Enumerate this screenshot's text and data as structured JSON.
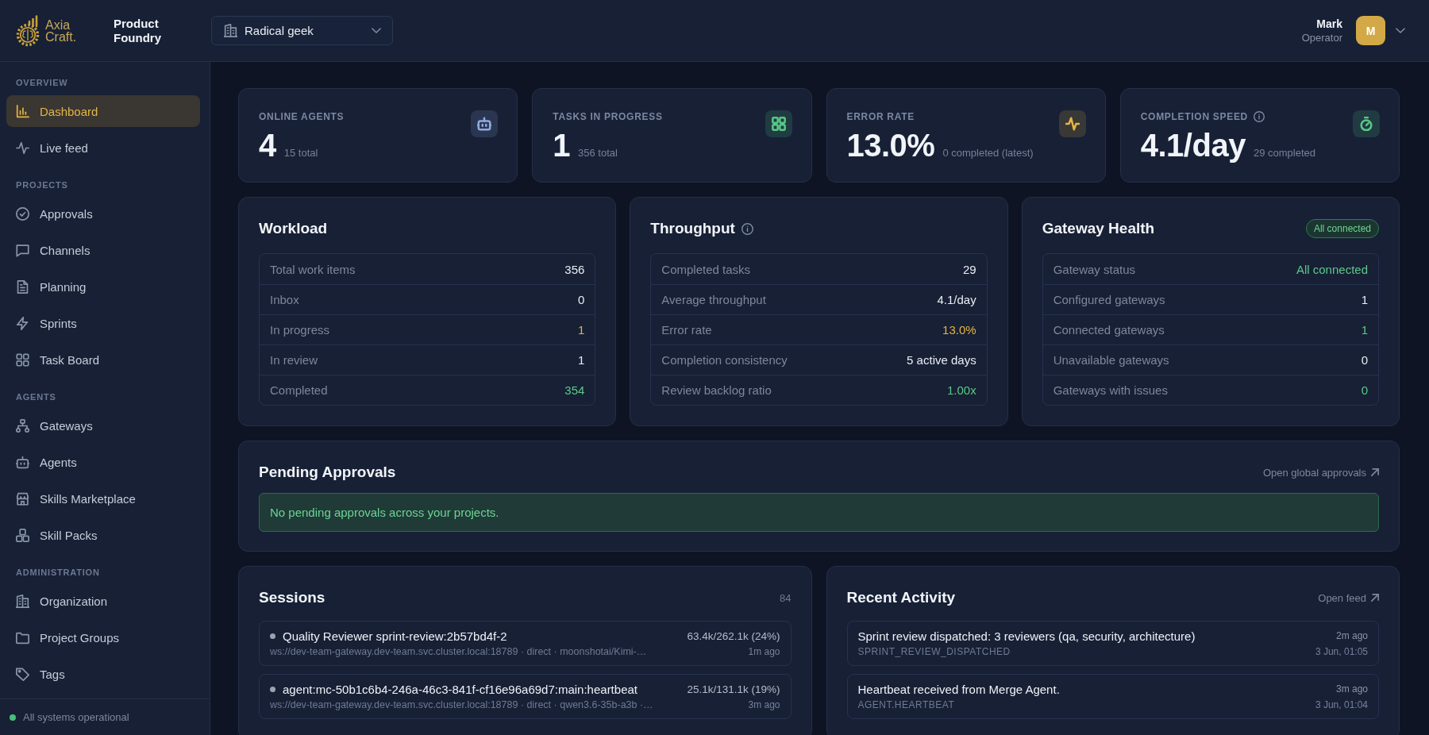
{
  "header": {
    "logo": {
      "lines": [
        "Axia",
        "Craft."
      ]
    },
    "app_name": "Product Foundry",
    "org_selector": {
      "value": "Radical geek"
    },
    "user": {
      "name": "Mark",
      "role": "Operator",
      "initial": "M"
    }
  },
  "sidebar": {
    "sections": [
      {
        "title": "OVERVIEW",
        "items": [
          {
            "label": "Dashboard",
            "selected": true
          },
          {
            "label": "Live feed",
            "selected": false
          }
        ]
      },
      {
        "title": "PROJECTS",
        "items": [
          {
            "label": "Approvals",
            "selected": false
          },
          {
            "label": "Channels",
            "selected": false
          },
          {
            "label": "Planning",
            "selected": false
          },
          {
            "label": "Sprints",
            "selected": false
          },
          {
            "label": "Task Board",
            "selected": false
          }
        ]
      },
      {
        "title": "AGENTS",
        "items": [
          {
            "label": "Gateways",
            "selected": false
          },
          {
            "label": "Agents",
            "selected": false
          },
          {
            "label": "Skills Marketplace",
            "selected": false
          },
          {
            "label": "Skill Packs",
            "selected": false
          }
        ]
      },
      {
        "title": "ADMINISTRATION",
        "items": [
          {
            "label": "Organization",
            "selected": false
          },
          {
            "label": "Project Groups",
            "selected": false
          },
          {
            "label": "Tags",
            "selected": false
          }
        ]
      }
    ],
    "status": {
      "text": "All systems operational"
    }
  },
  "stats": [
    {
      "label": "ONLINE AGENTS",
      "info": false,
      "value": "4",
      "detail": "15 total",
      "color": "#8fa9e0"
    },
    {
      "label": "TASKS IN PROGRESS",
      "info": false,
      "value": "1",
      "detail": "356 total",
      "color": "#58c884"
    },
    {
      "label": "ERROR RATE",
      "info": false,
      "value": "13.0%",
      "detail": "0 completed (latest)",
      "color": "#e5b443"
    },
    {
      "label": "COMPLETION SPEED",
      "info": true,
      "value": "4.1/day",
      "detail": "29 completed",
      "color": "#58c884"
    }
  ],
  "panels": [
    {
      "title": "Workload",
      "info": false,
      "rows": [
        {
          "label": "Total work items",
          "value": "356",
          "color": "#e8ecf3"
        },
        {
          "label": "Inbox",
          "value": "0",
          "color": "#e8ecf3"
        },
        {
          "label": "In progress",
          "value": "1",
          "color": "#e5b443"
        },
        {
          "label": "In review",
          "value": "1",
          "color": "#e8ecf3"
        },
        {
          "label": "Completed",
          "value": "354",
          "color": "#5cc987"
        }
      ]
    },
    {
      "title": "Throughput",
      "info": true,
      "rows": [
        {
          "label": "Completed tasks",
          "value": "29",
          "color": "#e8ecf3"
        },
        {
          "label": "Average throughput",
          "value": "4.1/day",
          "color": "#e8ecf3"
        },
        {
          "label": "Error rate",
          "value": "13.0%",
          "color": "#e5b443"
        },
        {
          "label": "Completion consistency",
          "value": "5 active days",
          "color": "#e8ecf3"
        },
        {
          "label": "Review backlog ratio",
          "value": "1.00x",
          "color": "#5cc987"
        }
      ]
    },
    {
      "title": "Gateway Health",
      "info": false,
      "badge": "All connected",
      "rows": [
        {
          "label": "Gateway status",
          "value": "All connected",
          "color": "#5cc987"
        },
        {
          "label": "Configured gateways",
          "value": "1",
          "color": "#e8ecf3"
        },
        {
          "label": "Connected gateways",
          "value": "1",
          "color": "#5cc987"
        },
        {
          "label": "Unavailable gateways",
          "value": "0",
          "color": "#e8ecf3"
        },
        {
          "label": "Gateways with issues",
          "value": "0",
          "color": "#5cc987"
        }
      ]
    }
  ],
  "pending_approvals": {
    "title": "Pending Approvals",
    "link": "Open global approvals",
    "message": "No pending approvals across your projects."
  },
  "sessions": {
    "title": "Sessions",
    "count": "84",
    "items": [
      {
        "title": "Quality Reviewer sprint-review:2b57bd4f-2",
        "detail": "ws://dev-team-gateway.dev-team.svc.cluster.local:18789 · direct · moonshotai/Kimi-…",
        "usage": "63.4k/262.1k (24%)",
        "time": "1m ago"
      },
      {
        "title": "agent:mc-50b1c6b4-246a-46c3-841f-cf16e96a69d7:main:heartbeat",
        "detail": "ws://dev-team-gateway.dev-team.svc.cluster.local:18789 · direct · qwen3.6-35b-a3b ·…",
        "usage": "25.1k/131.1k (19%)",
        "time": "3m ago"
      }
    ]
  },
  "recent_activity": {
    "title": "Recent Activity",
    "link": "Open feed",
    "items": [
      {
        "title": "Sprint review dispatched: 3 reviewers (qa, security, architecture)",
        "type": "SPRINT_REVIEW_DISPATCHED",
        "time": "2m ago",
        "date": "3 Jun, 01:05"
      },
      {
        "title": "Heartbeat received from Merge Agent.",
        "type": "AGENT.HEARTBEAT",
        "time": "3m ago",
        "date": "3 Jun, 01:04"
      }
    ]
  }
}
